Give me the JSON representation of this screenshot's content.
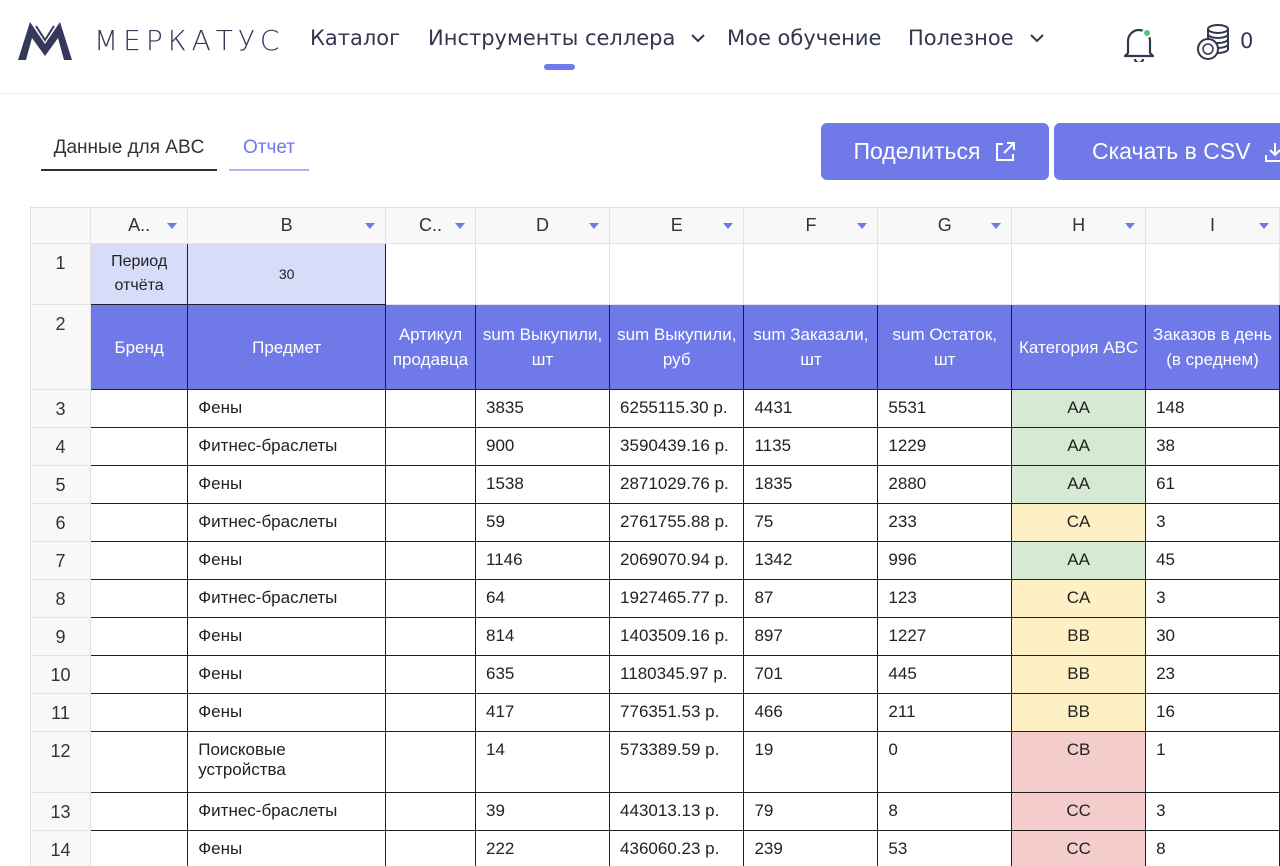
{
  "header": {
    "logo_text": "МЕРКАТУС",
    "nav": [
      {
        "label": "Каталог"
      },
      {
        "label": "Инструменты селлера"
      },
      {
        "label": "Мое обучение"
      },
      {
        "label": "Полезное"
      }
    ],
    "coin_count": "0"
  },
  "tabs": [
    {
      "label": "Данные для ABC"
    },
    {
      "label": "Отчет"
    }
  ],
  "actions": {
    "share_label": "Поделиться",
    "csv_label": "Скачать в CSV"
  },
  "sheet": {
    "columns": [
      "A..",
      "B",
      "C..",
      "D",
      "E",
      "F",
      "G",
      "H",
      "I"
    ],
    "row1": {
      "num": "1",
      "period_label": "Период отчёта",
      "period_value": "30"
    },
    "row2": {
      "num": "2",
      "headers": [
        "Бренд",
        "Предмет",
        "Артикул продавца",
        "sum Выкупили, шт",
        "sum Выкупили, руб",
        "sum Заказали, шт",
        "sum Остаток, шт",
        "Категория ABC",
        "Заказов в день (в среднем)"
      ]
    },
    "rows": [
      {
        "num": "3",
        "subject": "Фены",
        "bought_qty": "3835",
        "bought_rub": "6255115.30 р.",
        "ordered": "4431",
        "stock": "5531",
        "abc": "AA",
        "abc_color": "#d6ead3",
        "per_day": "148"
      },
      {
        "num": "4",
        "subject": "Фитнес-браслеты",
        "bought_qty": "900",
        "bought_rub": "3590439.16 р.",
        "ordered": "1135",
        "stock": "1229",
        "abc": "AA",
        "abc_color": "#d6ead3",
        "per_day": "38"
      },
      {
        "num": "5",
        "subject": "Фены",
        "bought_qty": "1538",
        "bought_rub": "2871029.76 р.",
        "ordered": "1835",
        "stock": "2880",
        "abc": "AA",
        "abc_color": "#d6ead3",
        "per_day": "61"
      },
      {
        "num": "6",
        "subject": "Фитнес-браслеты",
        "bought_qty": "59",
        "bought_rub": "2761755.88 р.",
        "ordered": "75",
        "stock": "233",
        "abc": "CA",
        "abc_color": "#fdf0c4",
        "per_day": "3"
      },
      {
        "num": "7",
        "subject": "Фены",
        "bought_qty": "1146",
        "bought_rub": "2069070.94 р.",
        "ordered": "1342",
        "stock": "996",
        "abc": "AA",
        "abc_color": "#d6ead3",
        "per_day": "45"
      },
      {
        "num": "8",
        "subject": "Фитнес-браслеты",
        "bought_qty": "64",
        "bought_rub": "1927465.77 р.",
        "ordered": "87",
        "stock": "123",
        "abc": "CA",
        "abc_color": "#fdf0c4",
        "per_day": "3"
      },
      {
        "num": "9",
        "subject": "Фены",
        "bought_qty": "814",
        "bought_rub": "1403509.16 р.",
        "ordered": "897",
        "stock": "1227",
        "abc": "BB",
        "abc_color": "#fdf0c4",
        "per_day": "30"
      },
      {
        "num": "10",
        "subject": "Фены",
        "bought_qty": "635",
        "bought_rub": "1180345.97 р.",
        "ordered": "701",
        "stock": "445",
        "abc": "BB",
        "abc_color": "#fdf0c4",
        "per_day": "23"
      },
      {
        "num": "11",
        "subject": "Фены",
        "bought_qty": "417",
        "bought_rub": "776351.53 р.",
        "ordered": "466",
        "stock": "211",
        "abc": "BB",
        "abc_color": "#fdf0c4",
        "per_day": "16"
      },
      {
        "num": "12",
        "subject": "Поисковые устройства",
        "bought_qty": "14",
        "bought_rub": "573389.59 р.",
        "ordered": "19",
        "stock": "0",
        "abc": "CB",
        "abc_color": "#f4cccc",
        "per_day": "1"
      },
      {
        "num": "13",
        "subject": "Фитнес-браслеты",
        "bought_qty": "39",
        "bought_rub": "443013.13 р.",
        "ordered": "79",
        "stock": "8",
        "abc": "CC",
        "abc_color": "#f4cccc",
        "per_day": "3"
      },
      {
        "num": "14",
        "subject": "Фены",
        "bought_qty": "222",
        "bought_rub": "436060.23 р.",
        "ordered": "239",
        "stock": "53",
        "abc": "CC",
        "abc_color": "#f4cccc",
        "per_day": "8"
      }
    ]
  },
  "colors": {
    "accent": "#6f79e8",
    "header_fill": "#6f79e8",
    "period_fill": "#d7dcf8",
    "abc_green": "#d6ead3",
    "abc_yellow": "#fdf0c4",
    "abc_red": "#f4cccc",
    "notification_dot": "#4cc78a"
  },
  "icons": [
    "merkatus-logo-icon",
    "chevron-down-icon",
    "bell-icon",
    "coins-icon",
    "external-link-icon",
    "download-icon",
    "dropdown-caret-icon"
  ]
}
